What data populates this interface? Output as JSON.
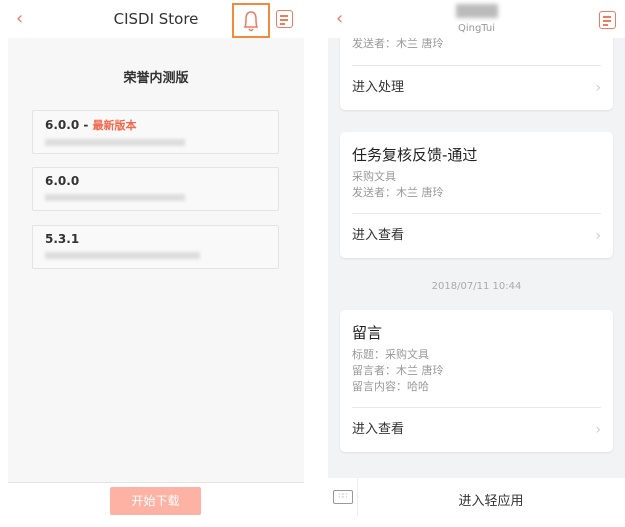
{
  "left": {
    "header": {
      "title": "CISDI Store",
      "back_icon": "‹"
    },
    "section_title": "荣誉内测版",
    "versions": [
      {
        "version": "6.0.0",
        "separator": " - ",
        "tag": "最新版本"
      },
      {
        "version": "6.0.0"
      },
      {
        "version": "5.3.1"
      }
    ],
    "download_button": "开始下载",
    "accent": "#f07a5e"
  },
  "right": {
    "header": {
      "subtitle": "QingTui",
      "back_icon": "‹"
    },
    "card1": {
      "sender": "发送者：木兰 唐玲",
      "action": "进入处理"
    },
    "card2": {
      "title": "任务复核反馈-通过",
      "line1": "采购文具",
      "sender": "发送者：木兰 唐玲",
      "action": "进入查看"
    },
    "timestamp": "2018/07/11 10:44",
    "card3": {
      "title": "留言",
      "line1": "标题：采购文具",
      "line2": "留言者：木兰 唐玲",
      "line3": "留言内容：哈哈",
      "action": "进入查看"
    },
    "footer": {
      "label": "进入轻应用"
    }
  }
}
